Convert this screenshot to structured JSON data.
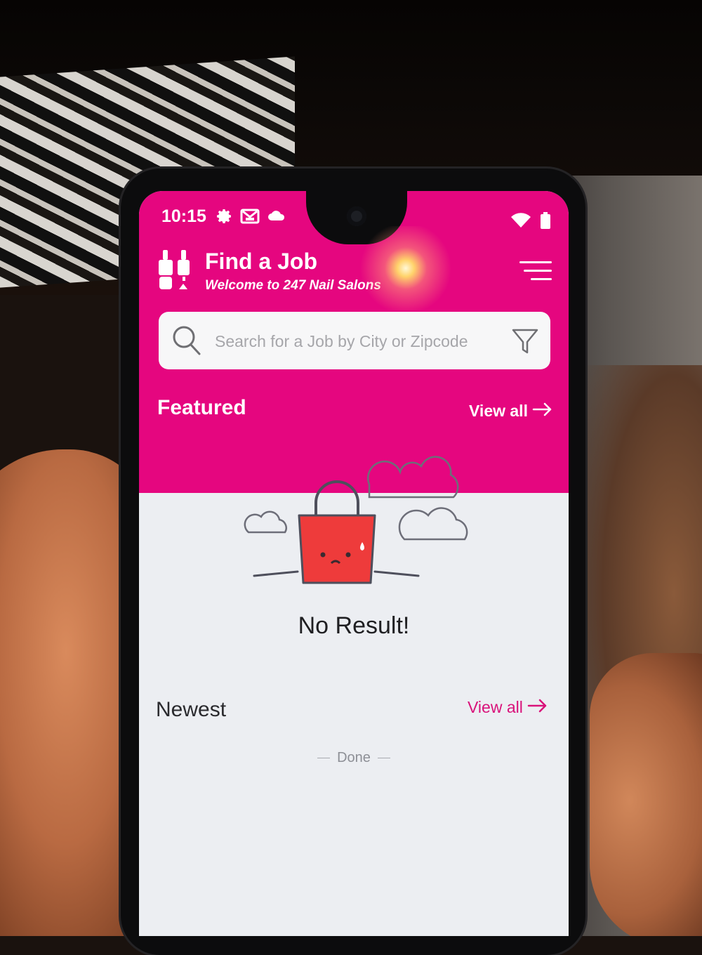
{
  "status_bar": {
    "time": "10:15",
    "left_icons": [
      "gear-icon",
      "gmail-icon",
      "cloud-icon"
    ],
    "right_icons": [
      "wifi-icon",
      "battery-icon"
    ]
  },
  "header": {
    "title": "Find a Job",
    "subtitle": "Welcome to 247 Nail Salons",
    "menu_icon": "hamburger-menu-icon"
  },
  "search": {
    "placeholder": "Search for a Job by City or Zipcode",
    "value": ""
  },
  "featured": {
    "title": "Featured",
    "view_all": "View all",
    "empty_text": "No Result!"
  },
  "newest": {
    "title": "Newest",
    "view_all": "View all"
  },
  "list_status": "Done",
  "colors": {
    "brand_pink": "#e5067f",
    "link_pink": "#d9127a",
    "bag_red": "#ee3b3b",
    "background": "#eceef2"
  }
}
